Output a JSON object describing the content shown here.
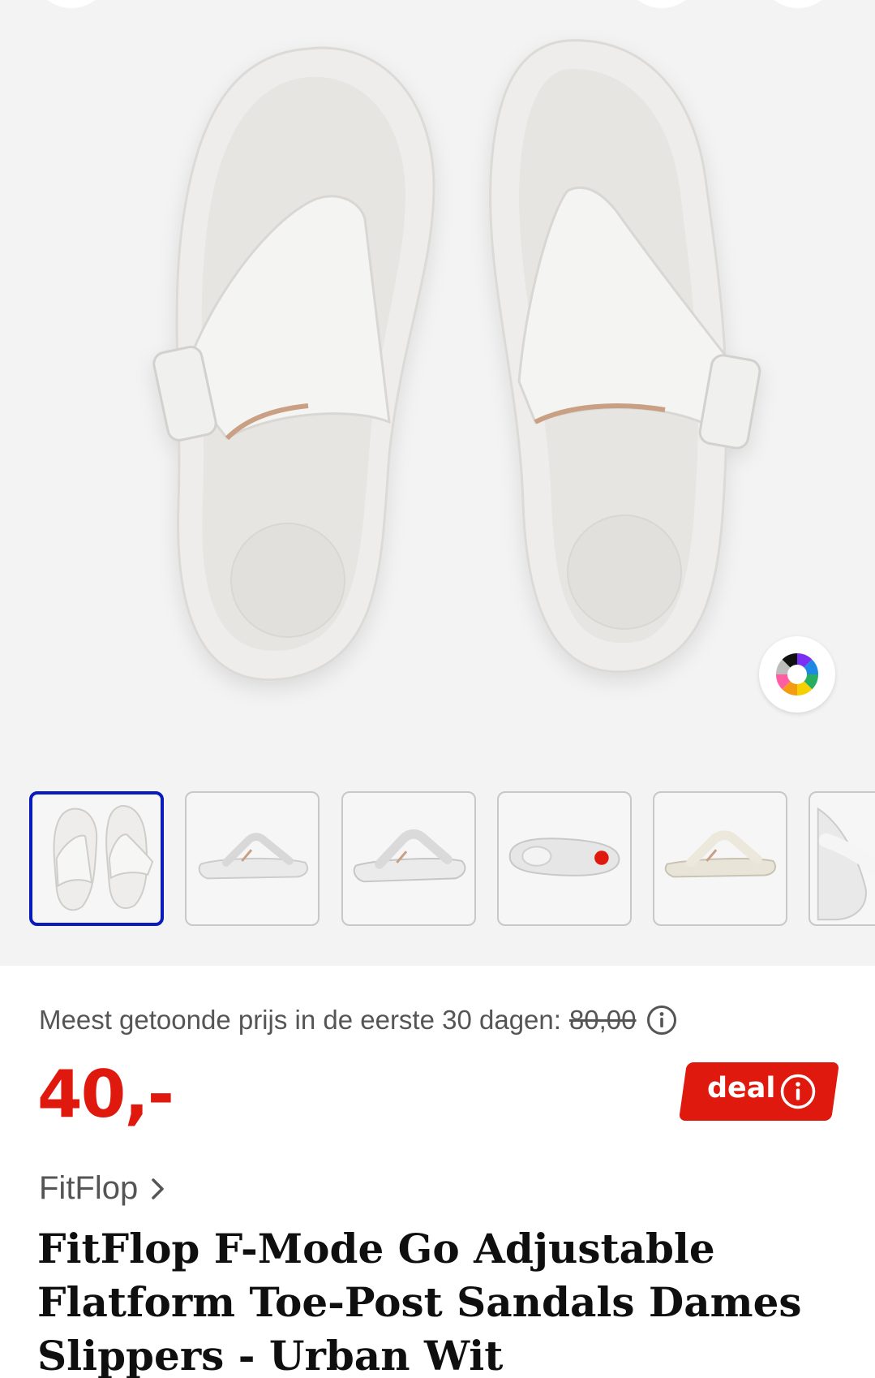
{
  "gallery": {
    "main_image_alt": "",
    "thumbnails": [
      {
        "icon": "sandals-top-view-thumbnail",
        "active": true
      },
      {
        "icon": "sandal-side-view-thumbnail",
        "active": false
      },
      {
        "icon": "sandal-side-view-2-thumbnail",
        "active": false
      },
      {
        "icon": "sandal-sole-view-thumbnail",
        "active": false
      },
      {
        "icon": "sandal-beige-side-view-thumbnail",
        "active": false
      },
      {
        "icon": "sandal-detail-thumbnail",
        "active": false
      }
    ],
    "color_picker_icon": "color-wheel-icon"
  },
  "pricing": {
    "lowest_price_label": "Meest getoonde prijs in de eerste 30 dagen:",
    "lowest_price_value": "80,00",
    "current_price": "40,-",
    "deal_label": "deal"
  },
  "product": {
    "brand": "FitFlop",
    "title": "FitFlop F-Mode Go Adjustable Flatform Toe-Post Sandals Dames Slippers - Urban Wit"
  },
  "colors": {
    "price_red": "#e0190f",
    "active_thumb_border": "#0a1bbd",
    "muted_text": "#555555"
  }
}
